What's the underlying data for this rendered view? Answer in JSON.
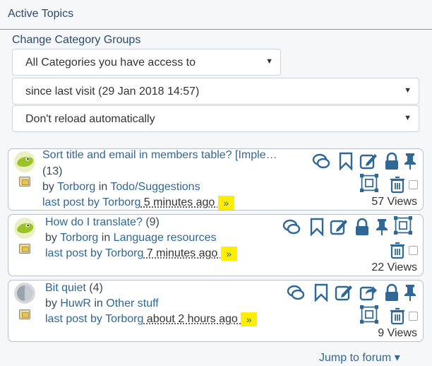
{
  "header": {
    "title": "Active Topics"
  },
  "category": {
    "label": "Change Category Groups"
  },
  "selects": [
    {
      "value": "All Categories you have access to"
    },
    {
      "value": "since last visit (29 Jan 2018 14:57)"
    },
    {
      "value": "Don't reload automatically"
    }
  ],
  "topics": [
    {
      "title": "Sort title and email in members table? [Imple…",
      "count": "(13)",
      "by": "by",
      "author": "Torborg",
      "in": "in",
      "category": "Todo/Suggestions",
      "last_post_label": "last post by",
      "last_author": "Torborg",
      "time": " 5 minutes ago ",
      "jump": "»",
      "views": "57 Views"
    },
    {
      "title": "How do I translate?",
      "count": "(9)",
      "by": "by",
      "author": "Torborg",
      "in": "in",
      "category": "Language resources",
      "last_post_label": "last post by",
      "last_author": "Torborg",
      "time": " 7 minutes ago ",
      "jump": "»",
      "views": "22 Views"
    },
    {
      "title": "Bit quiet",
      "count": "(4)",
      "by": "by",
      "author": "HuwR",
      "in": "in",
      "category": "Other stuff",
      "last_post_label": "last post by",
      "last_author": "Torborg",
      "time": " about 2 hours ago ",
      "jump": "»",
      "views": "9 Views"
    }
  ],
  "footer": {
    "jump_to_forum": "Jump to forum ▾"
  },
  "colors": {
    "accent": "#2f6796",
    "highlight": "#ffee00",
    "border": "#b9c1cb"
  }
}
